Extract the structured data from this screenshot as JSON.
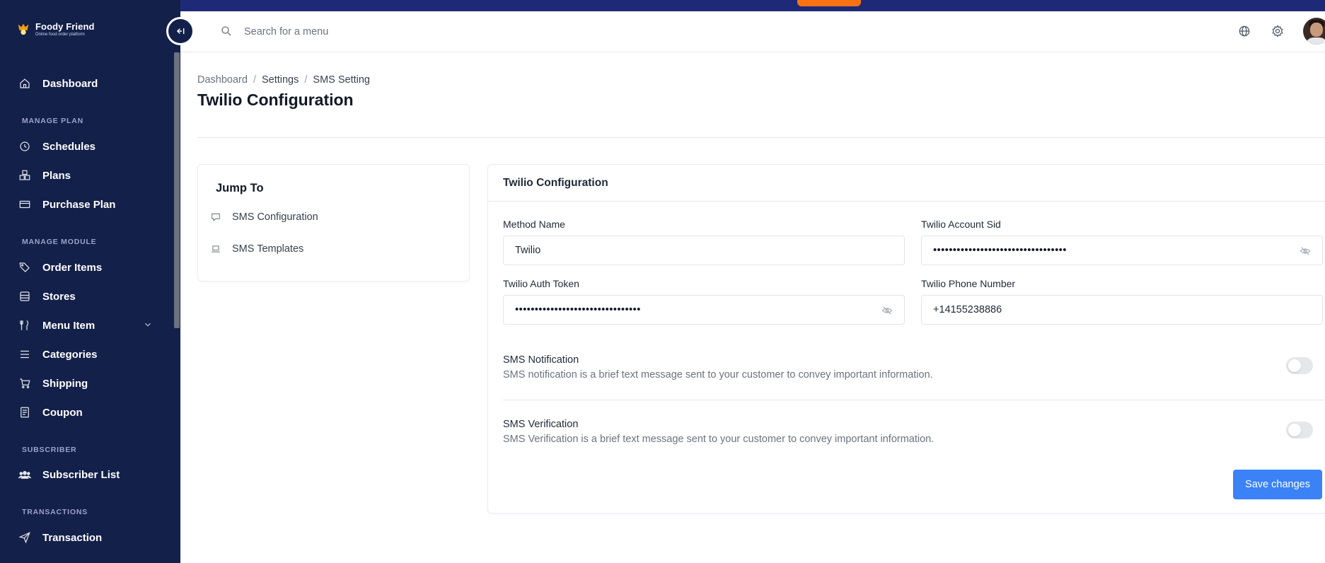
{
  "app": {
    "logo_name": "Foody Friend",
    "logo_tagline": "Online food order platform"
  },
  "sidebar": {
    "collapse_icon": "collapse-left-icon",
    "items": [
      {
        "label": "Dashboard",
        "icon": "home-icon"
      },
      {
        "section": "MANAGE PLAN"
      },
      {
        "label": "Schedules",
        "icon": "clock-icon"
      },
      {
        "label": "Plans",
        "icon": "cubes-icon"
      },
      {
        "label": "Purchase Plan",
        "icon": "credit-card-icon"
      },
      {
        "section": "MANAGE MODULE"
      },
      {
        "label": "Order Items",
        "icon": "tag-icon"
      },
      {
        "label": "Stores",
        "icon": "store-icon"
      },
      {
        "label": "Menu Item",
        "icon": "utensils-icon",
        "expandable": true
      },
      {
        "label": "Categories",
        "icon": "list-icon"
      },
      {
        "label": "Shipping",
        "icon": "cart-icon"
      },
      {
        "label": "Coupon",
        "icon": "receipt-icon"
      },
      {
        "section": "SUBSCRIBER"
      },
      {
        "label": "Subscriber List",
        "icon": "users-icon"
      },
      {
        "section": "TRANSACTIONS"
      },
      {
        "label": "Transaction",
        "icon": "send-icon"
      }
    ]
  },
  "header": {
    "search_placeholder": "Search for a menu",
    "icons": [
      "globe-icon",
      "gear-icon"
    ]
  },
  "breadcrumb": {
    "items": [
      "Dashboard",
      "Settings",
      "SMS Setting"
    ],
    "separator": "/"
  },
  "page": {
    "title": "Twilio Configuration"
  },
  "jump_to": {
    "title": "Jump To",
    "links": [
      {
        "label": "SMS Configuration",
        "icon": "message-icon"
      },
      {
        "label": "SMS Templates",
        "icon": "laptop-icon"
      }
    ]
  },
  "config": {
    "title": "Twilio Configuration",
    "fields": {
      "method_name": {
        "label": "Method Name",
        "value": "Twilio"
      },
      "account_sid": {
        "label": "Twilio Account Sid",
        "value": "••••••••••••••••••••••••••••••••••"
      },
      "auth_token": {
        "label": "Twilio Auth Token",
        "value": "••••••••••••••••••••••••••••••••"
      },
      "phone_number": {
        "label": "Twilio Phone Number",
        "value": "+14155238886"
      }
    },
    "toggles": [
      {
        "title": "SMS Notification",
        "description": "SMS notification is a brief text message sent to your customer to convey important information.",
        "enabled": false
      },
      {
        "title": "SMS Verification",
        "description": "SMS Verification is a brief text message sent to your customer to convey important information.",
        "enabled": false
      }
    ],
    "save_label": "Save changes"
  },
  "colors": {
    "sidebar_bg": "#13204a",
    "primary": "#3b82f6",
    "accent_orange": "#f97316"
  }
}
